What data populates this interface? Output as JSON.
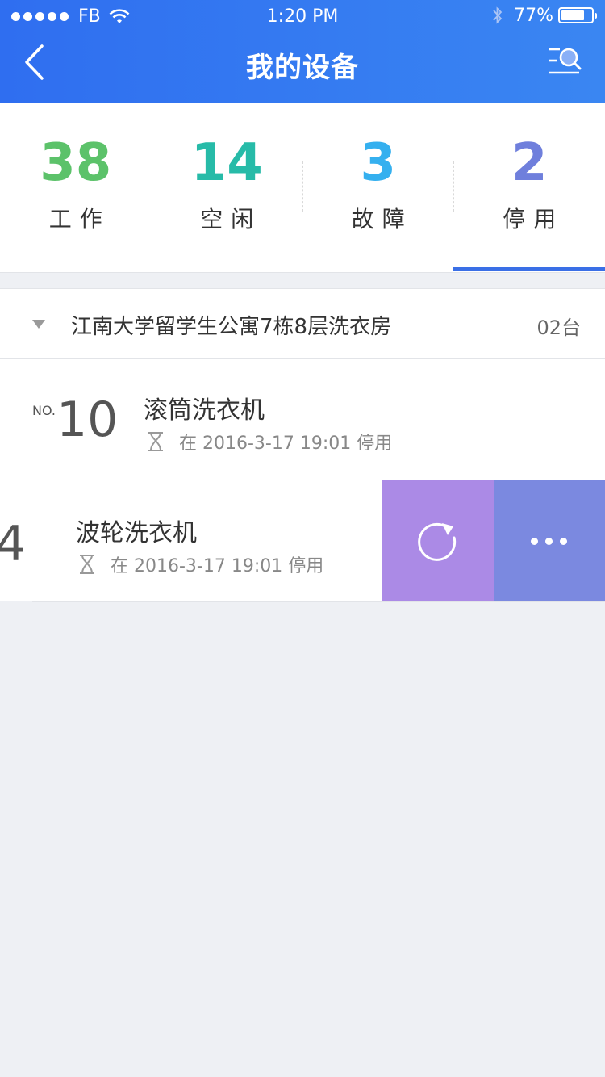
{
  "status_bar": {
    "carrier": "FB",
    "time": "1:20 PM",
    "battery": "77%",
    "battery_level": 0.77
  },
  "nav": {
    "title": "我的设备"
  },
  "stats": [
    {
      "value": "38",
      "label": "工作",
      "color": "#5cc26a"
    },
    {
      "value": "14",
      "label": "空闲",
      "color": "#27bba8"
    },
    {
      "value": "3",
      "label": "故障",
      "color": "#35b0ef"
    },
    {
      "value": "2",
      "label": "停用",
      "color": "#6f7fdc"
    }
  ],
  "group": {
    "name": "江南大学留学生公寓7栋8层洗衣房",
    "count": "02台"
  },
  "devices": [
    {
      "no_label": "NO.",
      "number": "10",
      "name": "滚筒洗衣机",
      "status": "在 2016-3-17 19:01 停用"
    },
    {
      "number": "4",
      "name": "波轮洗衣机",
      "status": "在 2016-3-17 19:01 停用"
    }
  ],
  "colors": {
    "header": "#3478f0",
    "restore_action": "#ab8ae6",
    "more_action": "#7b89e0",
    "active_tab": "#3a6fe6"
  }
}
